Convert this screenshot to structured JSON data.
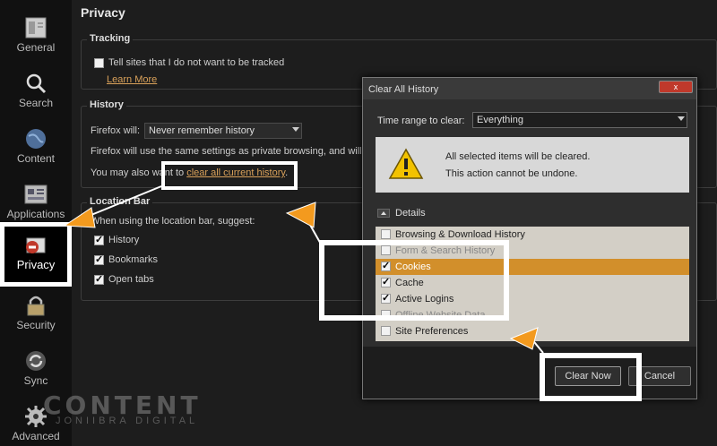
{
  "sidebar": {
    "items": [
      {
        "label": "General",
        "icon": "general-icon"
      },
      {
        "label": "Search",
        "icon": "magnifier-icon"
      },
      {
        "label": "Content",
        "icon": "globe-icon"
      },
      {
        "label": "Applications",
        "icon": "applications-icon"
      },
      {
        "label": "Privacy",
        "icon": "privacy-icon",
        "active": true
      },
      {
        "label": "Security",
        "icon": "lock-icon"
      },
      {
        "label": "Sync",
        "icon": "sync-icon"
      },
      {
        "label": "Advanced",
        "icon": "gear-icon"
      }
    ]
  },
  "main": {
    "title": "Privacy",
    "tracking": {
      "caption": "Tracking",
      "checkbox_label": "Tell sites that I do not want to be tracked",
      "learn_more": "Learn More"
    },
    "history": {
      "caption": "History",
      "will_label": "Firefox will:",
      "will_value": "Never remember history",
      "description": "Firefox will use the same settings as private browsing, and will no",
      "clear_prefix": "You may also want to",
      "clear_link": "clear all current history",
      "clear_suffix": "."
    },
    "location_bar": {
      "caption": "Location Bar",
      "suggest_label": "When using the location bar, suggest:",
      "options": [
        {
          "label": "History",
          "checked": true
        },
        {
          "label": "Bookmarks",
          "checked": true
        },
        {
          "label": "Open tabs",
          "checked": true
        }
      ]
    }
  },
  "dialog": {
    "title": "Clear All History",
    "close_label": "x",
    "time_range_label": "Time range to clear:",
    "time_range_value": "Everything",
    "warning_line1": "All selected items will be cleared.",
    "warning_line2": "This action cannot be undone.",
    "details_label": "Details",
    "items": [
      {
        "label": "Browsing & Download History",
        "checked": false
      },
      {
        "label": "Form & Search History",
        "checked": false
      },
      {
        "label": "Cookies",
        "checked": true,
        "selected": true
      },
      {
        "label": "Cache",
        "checked": true
      },
      {
        "label": "Active Logins",
        "checked": true
      },
      {
        "label": "Offline Website Data",
        "checked": false
      },
      {
        "label": "Site Preferences",
        "checked": false
      }
    ],
    "clear_now": "Clear Now",
    "cancel": "Cancel"
  },
  "watermark": {
    "main": "CONTENT",
    "sub": "JONIIBRA DIGITAL"
  },
  "colors": {
    "accent": "#d28f2b",
    "highlight_arrow": "#f39a1e",
    "link": "#d9a15a"
  }
}
